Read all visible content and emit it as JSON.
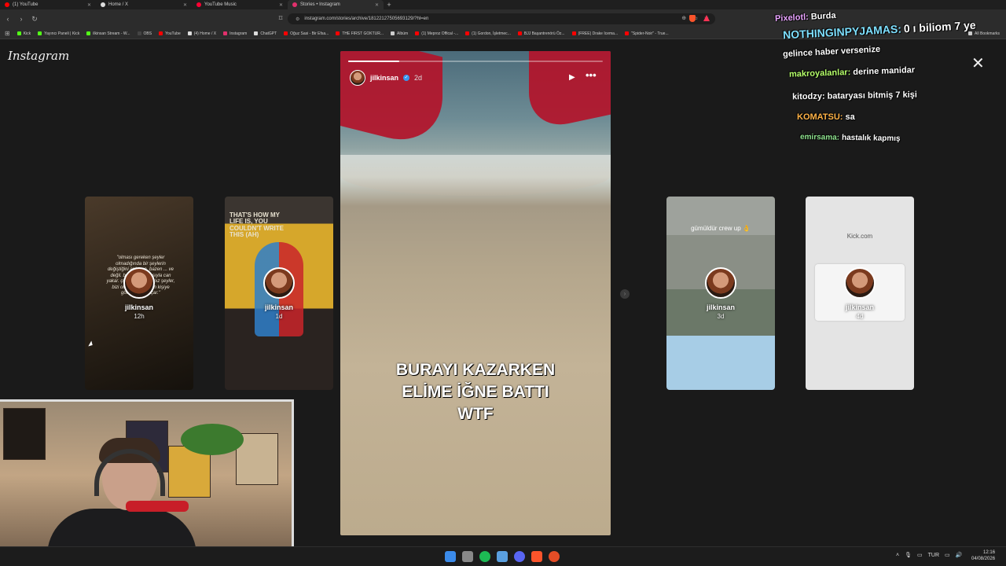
{
  "browser": {
    "tabs": [
      {
        "label": "(1) YouTube",
        "color": "#ff0000"
      },
      {
        "label": "Home / X",
        "color": "#dddddd"
      },
      {
        "label": "YouTube Music",
        "color": "#ff0033"
      },
      {
        "label": "Stories • Instagram",
        "color": "#e1306c"
      }
    ],
    "new_tab": "+",
    "url": "instagram.com/stories/archive/18122127505693129/?hl=en",
    "bookmarks": [
      {
        "label": "Kick",
        "color": "#53fc18"
      },
      {
        "label": "Yayıncı Paneli | Kick",
        "color": "#53fc18"
      },
      {
        "label": "ilkinsan Stream - W...",
        "color": "#53fc18"
      },
      {
        "label": "OBS",
        "color": "#444444"
      },
      {
        "label": "YouTube",
        "color": "#ff0000"
      },
      {
        "label": "(4) Home / X",
        "color": "#dddddd"
      },
      {
        "label": "Instagram",
        "color": "#e1306c"
      },
      {
        "label": "ChatGPT",
        "color": "#dddddd"
      },
      {
        "label": "Oğuz Sasi - Bir Efsa...",
        "color": "#ff0000"
      },
      {
        "label": "THE FIRST GOKTUR...",
        "color": "#ff0000"
      },
      {
        "label": "Albüm",
        "color": "#cccccc"
      },
      {
        "label": "(1) Meproz Offical -...",
        "color": "#ff0000"
      },
      {
        "label": "(1) Gordon, İşletmec...",
        "color": "#ff0000"
      },
      {
        "label": "BJJ Başantrenörü Öz...",
        "color": "#ff0000"
      },
      {
        "label": "(FREE) Drake Icema...",
        "color": "#ff0000"
      },
      {
        "label": "\"Spider-Noir\" - True...",
        "color": "#ff0000"
      },
      {
        "label": "All Bookmarks",
        "color": "#cccccc"
      }
    ]
  },
  "instagram": {
    "logo": "Instagram",
    "side_stories": [
      {
        "user": "jilkinsan",
        "time": "12h",
        "quote": "\"olması gereken şeyler olmadığında bir şeylerin değiştiğini anlarsın. bazen ... ve değil. bazen ... fazlasıyla can yakar. çünkü yaşadığımız şeyler, bizi olmamız gereken kişiye götüren yolu açar.\""
      },
      {
        "user": "jilkinsan",
        "time": "1d",
        "quote": "THAT'S HOW MY LIFE IS, YOU COULDN'T WRITE THIS (AH)"
      },
      {
        "user": "jilkinsan",
        "time": "3d",
        "quote": "gümüldür crew up 👌"
      },
      {
        "user": "jilkinsan",
        "time": "4d",
        "quote": "Kick.com"
      }
    ],
    "main_story": {
      "user": "jilkinsan",
      "time": "2d",
      "progress": 0.2,
      "caption_lines": [
        "BURAYI KAZARKEN",
        "ELİME İĞNE BATTI",
        "WTF"
      ]
    }
  },
  "chat": [
    {
      "nick": "Pixelotl:",
      "msg": "Burda",
      "nick_color": "#e9a4ff"
    },
    {
      "nick": "NOTHINGINPYJAMAS:",
      "msg": "0 ı biliom 7 ye",
      "nick_color": "#7ee0ff"
    },
    {
      "nick": "",
      "msg": "gelince haber versenize",
      "nick_color": "#ffffff"
    },
    {
      "nick": "makroyalanlar:",
      "msg": "derine manidar",
      "nick_color": "#b6ff6b"
    },
    {
      "nick": "kitodzy:",
      "msg": "bataryası bitmiş 7 kişi",
      "nick_color": "#ffffff"
    },
    {
      "nick": "KOMATSU:",
      "msg": "sa",
      "nick_color": "#ffb347"
    },
    {
      "nick": "emirsama:",
      "msg": "hastalık kapmış",
      "nick_color": "#8fe38f"
    }
  ],
  "taskbar": {
    "icon_colors": [
      "#3b8bea",
      "#888888",
      "#1db954",
      "#5aa0e0",
      "#5865f2",
      "#fb542b",
      "#e44d26"
    ],
    "lang": "TUR",
    "time": "12:16",
    "date": "04/08/2026"
  }
}
